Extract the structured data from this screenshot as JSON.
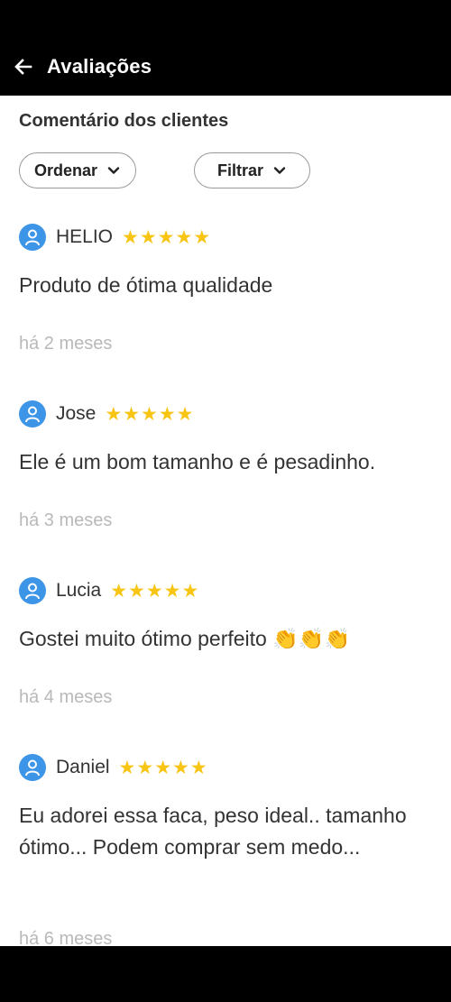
{
  "header": {
    "title": "Avaliações",
    "back_icon": "arrow-left-icon"
  },
  "section": {
    "title": "Comentário dos clientes"
  },
  "controls": {
    "sort_label": "Ordenar",
    "filter_label": "Filtrar",
    "dropdown_icon": "chevron-down-icon"
  },
  "reviews": [
    {
      "author": "HELIO",
      "rating": 5,
      "stars": "★★★★★",
      "text": "Produto de ótima qualidade",
      "date": "há 2 meses"
    },
    {
      "author": "Jose",
      "rating": 5,
      "stars": "★★★★★",
      "text": "Ele é um bom tamanho e é pesadinho.",
      "date": "há 3 meses"
    },
    {
      "author": "Lucia",
      "rating": 5,
      "stars": "★★★★★",
      "text": "Gostei muito ótimo perfeito 👏👏👏",
      "date": "há 4 meses"
    },
    {
      "author": "Daniel",
      "rating": 5,
      "stars": "★★★★★",
      "text": "Eu adorei essa faca, peso ideal.. tamanho ótimo... Podem comprar sem medo...",
      "date": "há 6 meses"
    }
  ],
  "colors": {
    "star": "#f8c515",
    "avatar": "#3d95e8",
    "topbar": "#000000",
    "date_text": "#b9b9b9"
  }
}
